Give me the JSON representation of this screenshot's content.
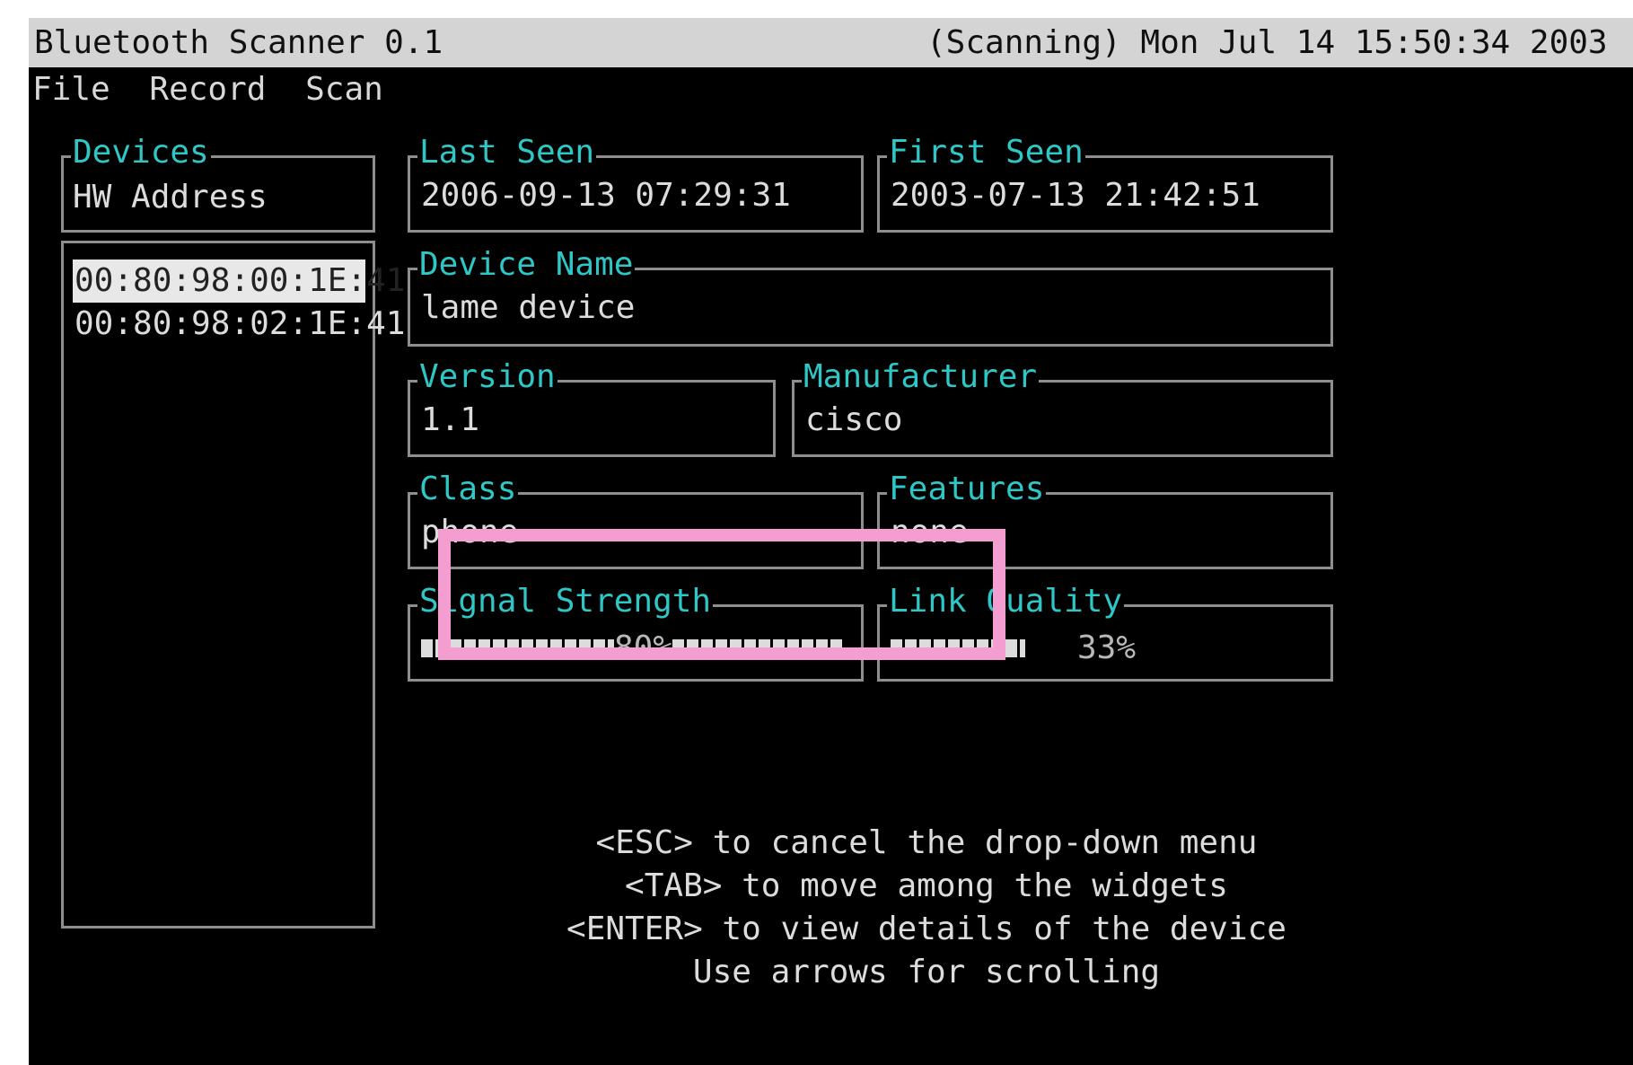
{
  "window": {
    "title": "Bluetooth Scanner 0.1",
    "status": "(Scanning) Mon Jul 14 15:50:34 2003"
  },
  "menu": {
    "items": [
      "File",
      "Record",
      "Scan"
    ]
  },
  "devices": {
    "label": "Devices",
    "column_header": "HW Address",
    "items": [
      "00:80:98:00:1E:41",
      "00:80:98:02:1E:41"
    ],
    "selected_index": 0
  },
  "fields": {
    "last_seen": {
      "label": "Last Seen",
      "value": "2006-09-13 07:29:31"
    },
    "first_seen": {
      "label": "First Seen",
      "value": "2003-07-13 21:42:51"
    },
    "device_name": {
      "label": "Device Name",
      "value": "lame device"
    },
    "version": {
      "label": "Version",
      "value": "1.1"
    },
    "manufacturer": {
      "label": "Manufacturer",
      "value": "cisco"
    },
    "class": {
      "label": "Class",
      "value": "phone"
    },
    "features": {
      "label": "Features",
      "value": "none"
    }
  },
  "signal_strength": {
    "label": "Signal Strength",
    "percent_text": "80%",
    "fraction": 0.8
  },
  "link_quality": {
    "label": "Link Quality",
    "percent_text": "33%",
    "fraction": 0.33
  },
  "help_lines": [
    "<ESC> to cancel the drop-down menu",
    "<TAB> to move among the widgets",
    "<ENTER> to view details of the device",
    "Use arrows for scrolling"
  ],
  "colors": {
    "label": "#2fc6c6",
    "text": "#dcdcdc",
    "background": "#000000",
    "highlight": "#f39dd1"
  }
}
